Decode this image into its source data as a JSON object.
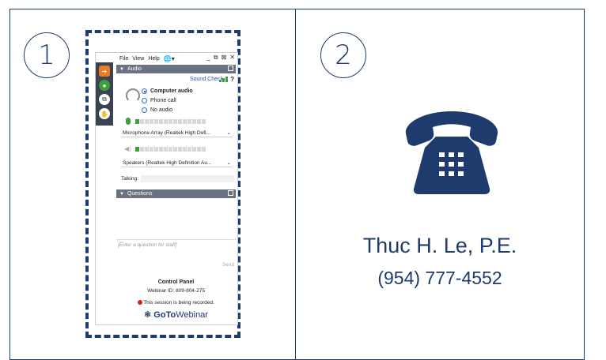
{
  "colors": {
    "accent": "#1f3b6e",
    "signal": "#3aa13a",
    "record": "#e01b1b"
  },
  "step1": {
    "number": "1"
  },
  "step2": {
    "number": "2"
  },
  "control_panel": {
    "menu": {
      "file": "File",
      "view": "View",
      "help": "Help",
      "language_icon": "globe-icon"
    },
    "window_buttons": [
      "_",
      "⧉",
      "⊠",
      "✕"
    ],
    "audio_section": {
      "title": "Audio",
      "sound_check": "Sound Check",
      "help": "?"
    },
    "audio_options": [
      {
        "label": "Computer audio",
        "selected": true
      },
      {
        "label": "Phone call",
        "selected": false
      },
      {
        "label": "No audio",
        "selected": false
      }
    ],
    "microphone": "Microphone Array (Realtek High Defi...",
    "speakers": "Speakers (Realtek High Definition Au...",
    "talking_label": "Talking:",
    "questions_section": {
      "title": "Questions"
    },
    "question_placeholder": "[Enter a question for staff]",
    "send_label": "Send",
    "footer": {
      "title": "Control Panel",
      "webinar_id": "Webinar ID: 809-804-275",
      "recording": "This session is being recorded.",
      "brand_bold": "GoTo",
      "brand_rest": "Webinar"
    }
  },
  "contact": {
    "name": "Thuc H. Le, P.E.",
    "phone": "(954) 777-4552",
    "icon": "telephone-icon"
  }
}
